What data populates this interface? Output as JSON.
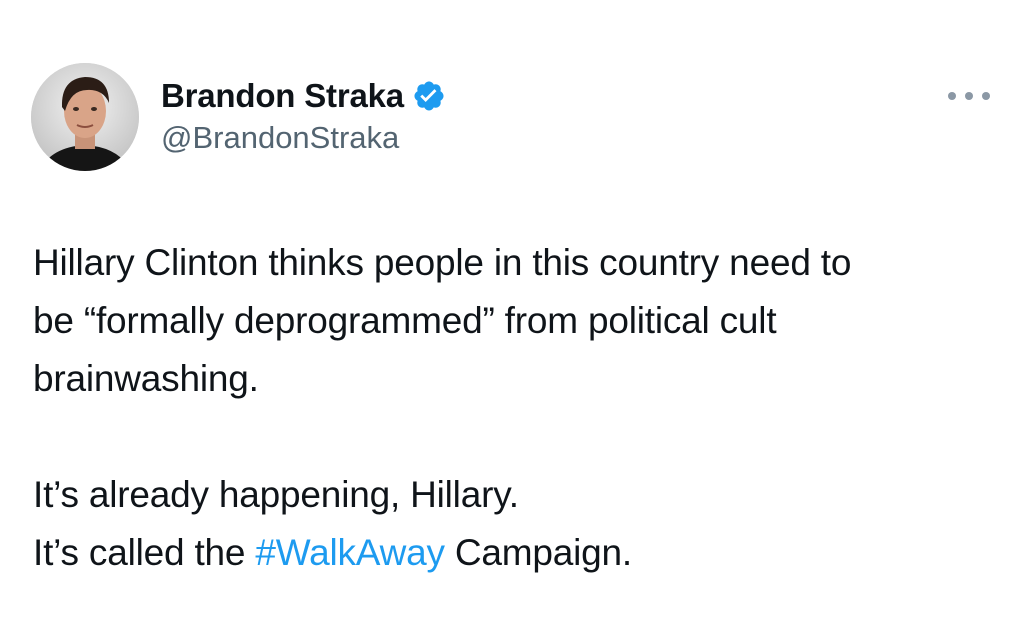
{
  "author": {
    "display_name": "Brandon Straka",
    "handle": "@BrandonStraka",
    "verified_icon": "verified-badge-icon",
    "avatar": "profile-photo",
    "colors": {
      "name": "#0f1419",
      "handle": "#536471",
      "verified": "#1d9bf0"
    }
  },
  "menu": {
    "icon": "more-options-icon"
  },
  "tweet": {
    "paragraph1": {
      "line1": "Hillary Clinton thinks people in this country need to",
      "line2": "be “formally deprogrammed” from political cult",
      "line3": "brainwashing."
    },
    "paragraph2": {
      "line1": "It’s already happening, Hillary.",
      "line2_prefix": "It’s called the ",
      "hashtag": "#WalkAway",
      "line2_suffix": " Campaign."
    },
    "colors": {
      "text": "#0f1419",
      "hashtag": "#1d9bf0"
    }
  }
}
